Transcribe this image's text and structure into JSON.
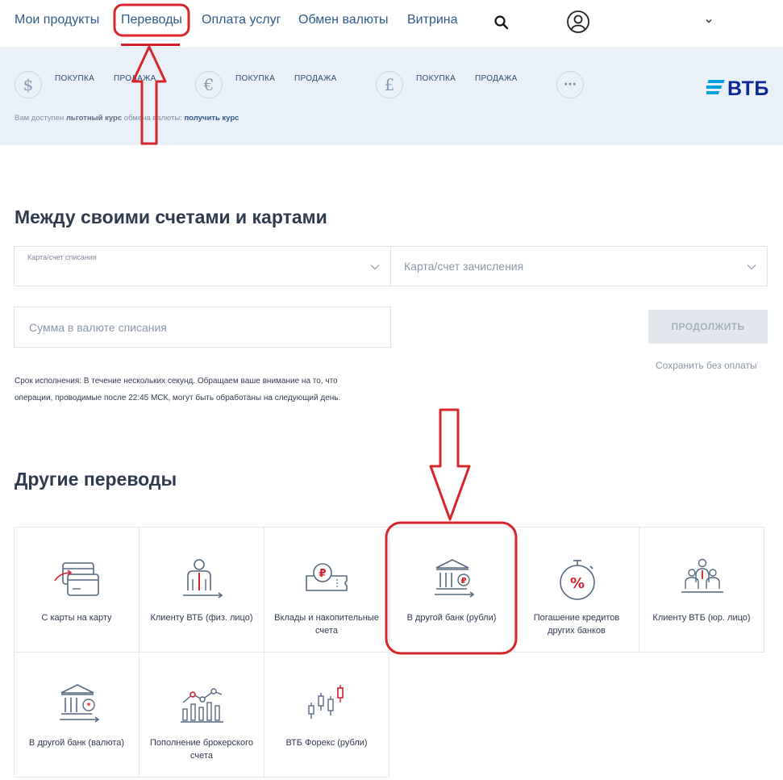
{
  "nav": {
    "items": [
      "Мои продукты",
      "Переводы",
      "Оплата услуг",
      "Обмен валюты",
      "Витрина"
    ],
    "active_index": 1
  },
  "rates": {
    "currencies": [
      {
        "symbol": "$",
        "buy_label": "ПОКУПКА",
        "sell_label": "ПРОДАЖА"
      },
      {
        "symbol": "€",
        "buy_label": "ПОКУПКА",
        "sell_label": "ПРОДАЖА"
      },
      {
        "symbol": "£",
        "buy_label": "ПОКУПКА",
        "sell_label": "ПРОДАЖА"
      }
    ],
    "more_symbol": "···",
    "note_prefix": "Вам доступен ",
    "note_bold": "льготный курс",
    "note_middle": " обмена валюты: ",
    "note_link": "получить курс",
    "logo_text": "ВТБ"
  },
  "own_transfer": {
    "title": "Между своими счетами и картами",
    "from_label": "Карта/счет списания",
    "to_placeholder": "Карта/счет зачисления",
    "amount_placeholder": "Сумма в валюте списания",
    "continue_label": "ПРОДОЛЖИТЬ",
    "save_label": "Сохранить без оплаты",
    "note_line1": "Срок исполнения: В течение нескольких секунд. Обращаем ваше внимание на то, что",
    "note_line2": "операции, проводимые после 22:45 МСК, могут быть обработаны на следующий день."
  },
  "other_transfers": {
    "title": "Другие переводы",
    "tiles": [
      {
        "label": "С карты на карту",
        "icon": "card-to-card-icon"
      },
      {
        "label": "Клиенту ВТБ (физ. лицо)",
        "icon": "person-client-icon"
      },
      {
        "label": "Вклады и накопительные счета",
        "icon": "deposit-icon"
      },
      {
        "label": "В другой банк (рубли)",
        "icon": "bank-rub-icon"
      },
      {
        "label": "Погашение кредитов других банков",
        "icon": "loan-repay-icon"
      },
      {
        "label": "Клиенту ВТБ (юр. лицо)",
        "icon": "legal-client-icon"
      },
      {
        "label": "В другой банк (валюта)",
        "icon": "bank-currency-icon"
      },
      {
        "label": "Пополнение брокерского счета",
        "icon": "brokerage-icon"
      },
      {
        "label": "ВТБ Форекс (рубли)",
        "icon": "forex-icon"
      }
    ]
  },
  "colors": {
    "accent": "#d4202c",
    "nav_text": "#2d5a8a",
    "rates_bg": "#eaf0f7",
    "vtb_blue": "#0a2896",
    "annotation_red": "#d6262b"
  }
}
